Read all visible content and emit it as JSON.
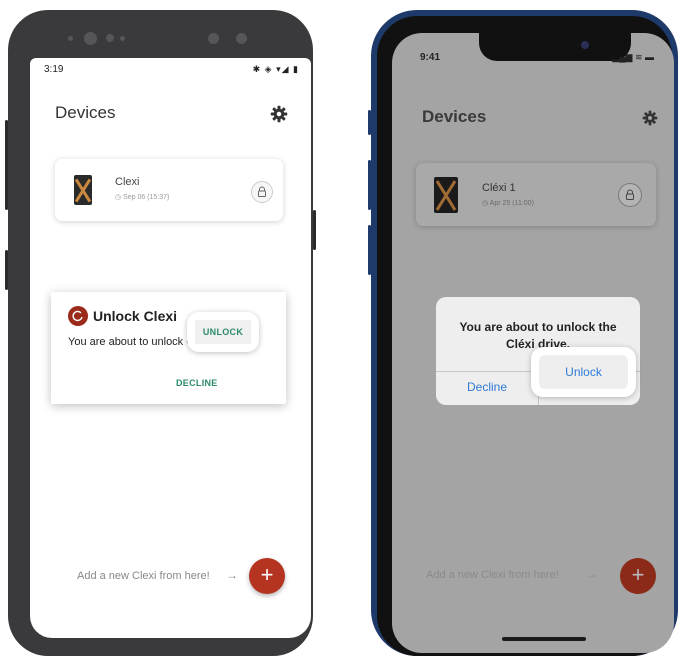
{
  "android": {
    "status_time": "3:19",
    "status_icons": "✱ ◈ ▾◢ ▮",
    "title": "Devices",
    "device": {
      "name": "Clexi",
      "date": "◷ Sep 06 (15:37)"
    },
    "dialog": {
      "title": "Unlock Clexi",
      "message": "You are about to unlock Clexi drive.",
      "decline": "DECLINE",
      "unlock": "UNLOCK"
    },
    "add_text": "Add a new Clexi from here!",
    "arrow": "→",
    "fab": "+"
  },
  "ios": {
    "status_time": "9:41",
    "status_icons": "▂▄▆ ≋ ▬",
    "title": "Devices",
    "device": {
      "name": "Cléxi 1",
      "date": "◷ Apr 25 (11:00)"
    },
    "alert": {
      "message_line1": "You are about to unlock the",
      "message_line2": "Cléxi drive.",
      "decline": "Decline",
      "unlock": "Unlock"
    },
    "add_text": "Add a new Clexi from here!",
    "arrow": "→",
    "fab": "+"
  },
  "colors": {
    "accent_red": "#b53321",
    "android_button_green": "#2a8a6a",
    "ios_blue": "#2f7bd8",
    "iphone_frame_blue": "#1e3a6a"
  },
  "icons": {
    "settings": "gear-icon",
    "lock": "lock-icon",
    "clock": "clock-icon",
    "add": "plus-icon",
    "arrow": "arrow-right-icon"
  }
}
